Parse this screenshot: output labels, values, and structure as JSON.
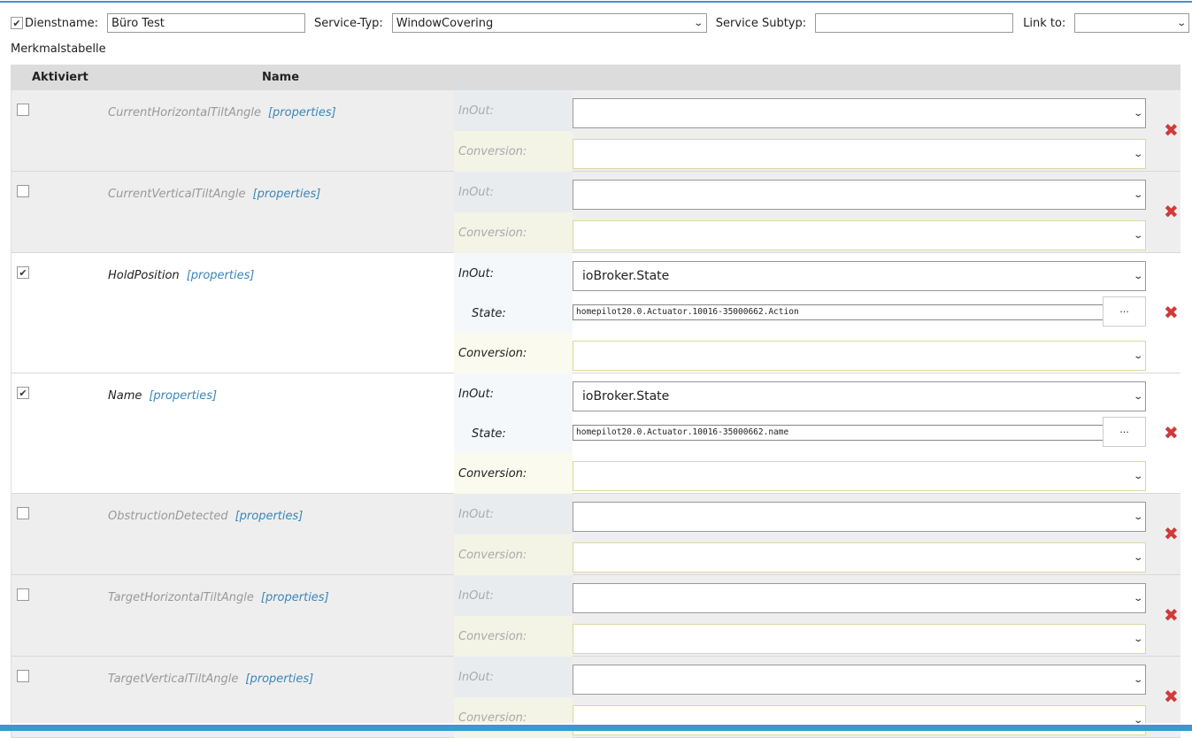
{
  "header": {
    "enabled": true,
    "service_name_label": "Dienstname:",
    "service_name_value": "Büro Test",
    "service_type_label": "Service-Typ:",
    "service_type_value": "WindowCovering",
    "subtype_label": "Service Subtyp:",
    "subtype_value": "",
    "link_label": "Link to:",
    "link_value": ""
  },
  "table_title": "Merkmalstabelle",
  "columns": {
    "activated": "Aktiviert",
    "name": "Name"
  },
  "labels": {
    "inout": "InOut:",
    "state": "State:",
    "conversion": "Conversion:",
    "properties": "[properties]",
    "browse": "···"
  },
  "rows": [
    {
      "name": "CurrentHorizontalTiltAngle",
      "active": false,
      "inout": "",
      "conversion": ""
    },
    {
      "name": "CurrentVerticalTiltAngle",
      "active": false,
      "inout": "",
      "conversion": ""
    },
    {
      "name": "HoldPosition",
      "active": true,
      "inout": "ioBroker.State",
      "state": "homepilot20.0.Actuator.10016-35000662.Action",
      "conversion": ""
    },
    {
      "name": "Name",
      "active": true,
      "inout": "ioBroker.State",
      "state": "homepilot20.0.Actuator.10016-35000662.name",
      "conversion": ""
    },
    {
      "name": "ObstructionDetected",
      "active": false,
      "inout": "",
      "conversion": ""
    },
    {
      "name": "TargetHorizontalTiltAngle",
      "active": false,
      "inout": "",
      "conversion": ""
    },
    {
      "name": "TargetVerticalTiltAngle",
      "active": false,
      "inout": "",
      "conversion": ""
    }
  ],
  "colors": {
    "accent": "#3a9ac9",
    "delete": "#d03a3a",
    "link": "#3a86b8"
  }
}
